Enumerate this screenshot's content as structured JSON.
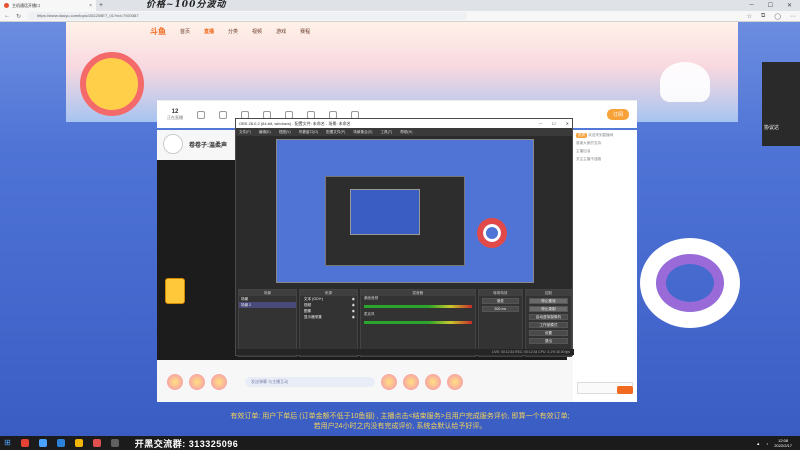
{
  "browser": {
    "tab_title": "主机通话开播口",
    "overlay_title": "价格~100分波动",
    "url": "https://www.douyu.com/topic/202205ET_01?rid=7920387"
  },
  "site": {
    "logo": "斗鱼",
    "nav": [
      "首页",
      "直播",
      "分类",
      "视频",
      "游戏",
      "赛程"
    ],
    "active_nav_index": 1
  },
  "infobar": {
    "stat_value": "12",
    "stat_label": "正在直播",
    "subscribe_label": "订阅"
  },
  "streamer": {
    "name": "卷卷子:温柔声"
  },
  "obs": {
    "title": "OBS 28.0.2 (64-bit, windows) - 配置文件: 未命名 - 场景: 未命名",
    "menu": [
      "文件(F)",
      "编辑(E)",
      "视图(V)",
      "停靠窗口(D)",
      "配置文件(P)",
      "场景集合(S)",
      "工具(T)",
      "帮助(H)"
    ],
    "docks": {
      "scenes": "场景",
      "sources": "来源",
      "mixer": "混音器",
      "transitions": "转场特效",
      "controls": "控制"
    },
    "scene_items": [
      "场景",
      "场景 2"
    ],
    "source_items": [
      "文本 (GDI+)",
      "视频",
      "图像",
      "显示器采集"
    ],
    "mixer_tracks": [
      "桌面音频",
      "麦克风"
    ],
    "transition_value": "渐变",
    "duration_value": "300 ms",
    "control_buttons": [
      "停止推流",
      "停止录制",
      "启动虚拟摄像机",
      "工作室模式",
      "设置",
      "退出"
    ],
    "status": "LIVE: 00:12:34  REC: 00:12:34  CPU: 3.1%  30.00 fps"
  },
  "chat": {
    "lines": [
      "欢迎来到直播间",
      "感谢大家的支持",
      "主播加油",
      "关注主播不迷路"
    ],
    "tag": "贵宾"
  },
  "gift_bar": {
    "placeholder": "发送弹幕 与主播互动"
  },
  "sidebar_right": {
    "label": "协议达"
  },
  "notice": {
    "line1": "有效订单: 用户下单后 (订单金额不低于10鱼翅) , 主播点击<结束服务>且用户完成服务评价, 即算一个有效订单;",
    "line2": "若用户24小时之内没有完成评价, 系统会默认给予好评。"
  },
  "taskbar": {
    "qq_group": "开黑交流群: 313325096",
    "time": "12:08",
    "date": "2022/2/17"
  },
  "colors": {
    "accent": "#f06a1f",
    "site_bg": "#3a5dc4",
    "obs_bg": "#2b2b2b"
  }
}
